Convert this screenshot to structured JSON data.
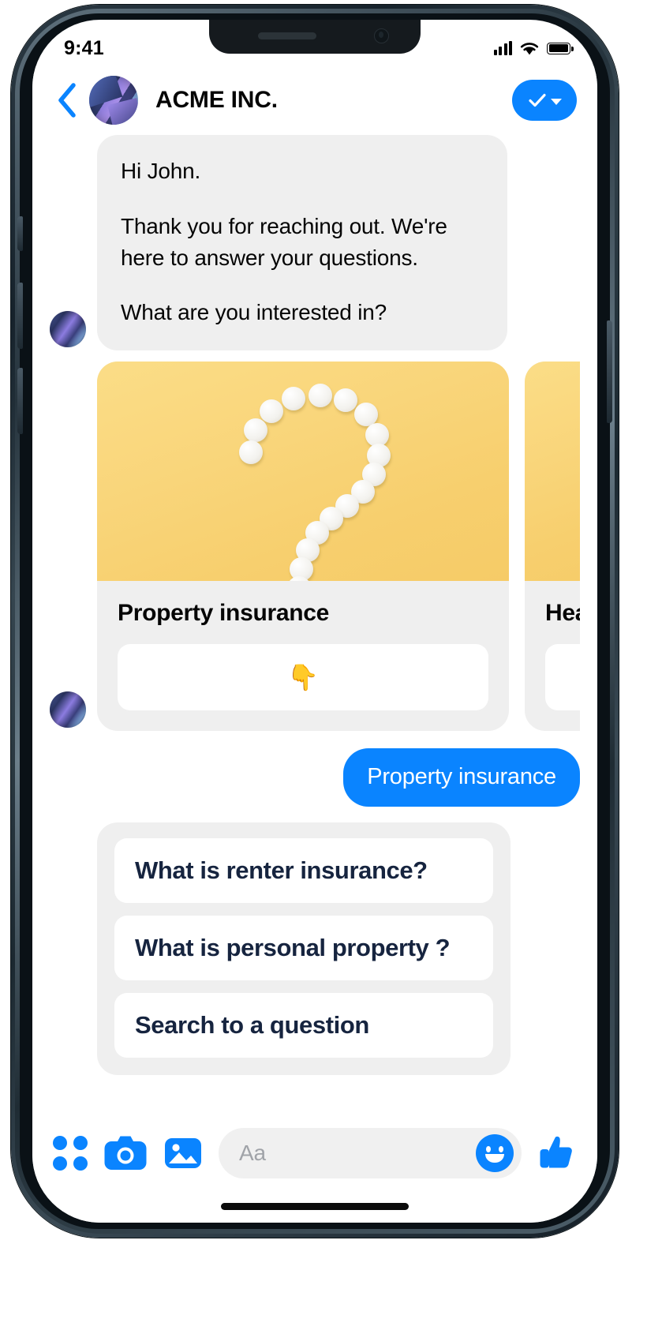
{
  "status_bar": {
    "time": "9:41",
    "signal_icon": "cellular-bars-icon",
    "wifi_icon": "wifi-icon",
    "battery_icon": "battery-full-icon"
  },
  "header": {
    "back_icon": "chevron-left-icon",
    "avatar_icon": "acme-avatar-icon",
    "title": "ACME INC.",
    "verified_icon": "check-icon",
    "verified_caret_icon": "chevron-down-icon",
    "accent_color": "#0a84ff"
  },
  "messages": [
    {
      "from": "bot",
      "avatar_icon": "bot-avatar-icon",
      "paragraphs": [
        "Hi John.",
        "Thank you for reaching out. We're here to answer your questions.",
        "What are you interested in?"
      ]
    }
  ],
  "carousel": {
    "avatar_icon": "bot-avatar-icon",
    "cards": [
      {
        "title": "Property insurance",
        "image_alt": "question-mark-made-of-pills-image",
        "image_bg": "#f9d57a",
        "button_label": "👇",
        "button_icon": "point-down-emoji"
      },
      {
        "title": "Health insurance",
        "image_alt": "second-card-image",
        "image_bg": "#f9d57a",
        "button_label": ""
      }
    ]
  },
  "user_reply": {
    "text": "Property insurance",
    "bubble_color": "#0a84ff"
  },
  "quick_replies": {
    "options": [
      "What is renter insurance?",
      "What is personal property ?",
      "Search to a question"
    ],
    "text_color": "#16243f"
  },
  "composer": {
    "grid_icon": "app-grid-icon",
    "camera_icon": "camera-icon",
    "gallery_icon": "photo-gallery-icon",
    "placeholder": "Aa",
    "value": "",
    "emoji_icon": "smiley-face-icon",
    "like_icon": "thumbs-up-icon",
    "accent_color": "#0a84ff"
  }
}
